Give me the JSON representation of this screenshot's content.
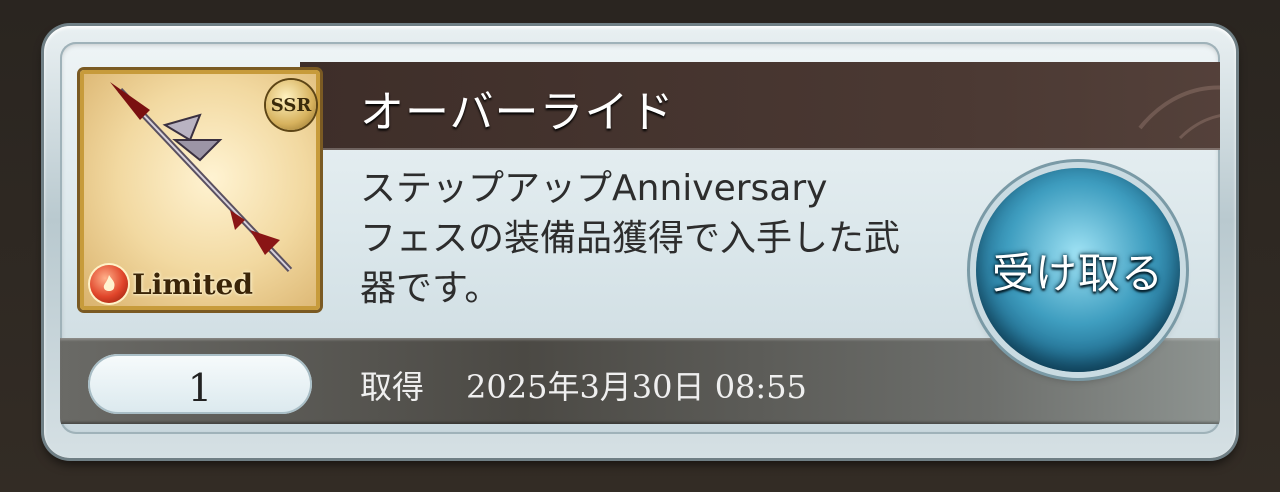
{
  "item": {
    "title": "オーバーライド",
    "description_line1": "ステップアップAnniversary",
    "description_line2": "フェスの装備品獲得で入手した武",
    "description_line3": "器です。",
    "rarity": "SSR",
    "tag": "Limited",
    "element_icon": "fire-icon",
    "quantity": "1",
    "obtained_label": "取得",
    "obtained_date": "2025年3月30日 08:55"
  },
  "actions": {
    "receive_label": "受け取る"
  },
  "colors": {
    "title_bar": "#4b3933",
    "receive_button": "#3f9ec0",
    "panel": "#dbe7eb"
  }
}
